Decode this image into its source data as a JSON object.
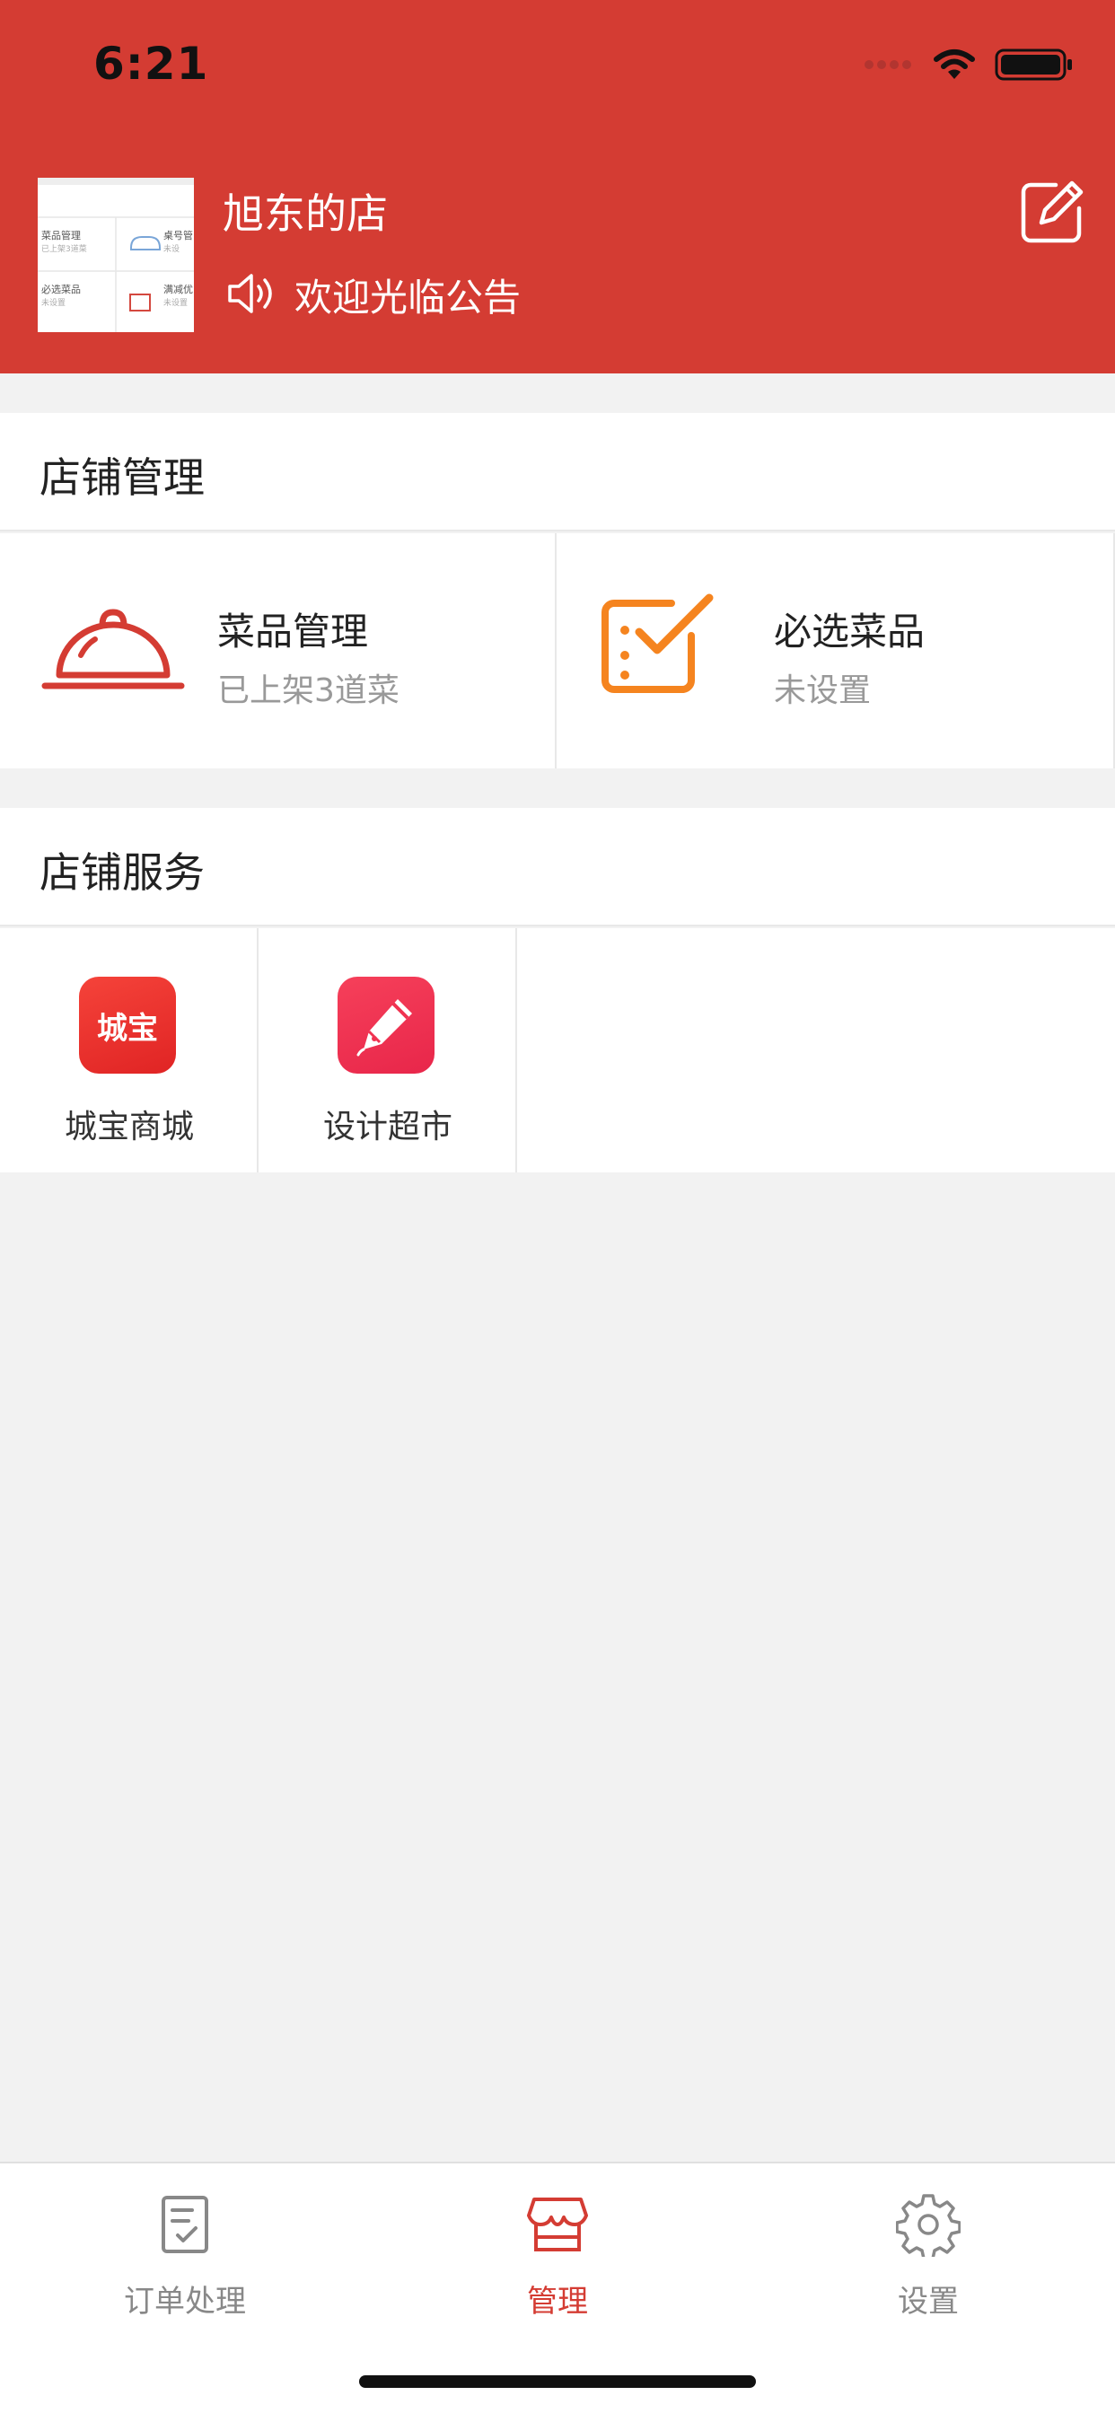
{
  "status_bar": {
    "time": "6:21"
  },
  "shop": {
    "name": "旭东的店",
    "notice": "欢迎光临公告",
    "thumbnail": {
      "top_left": "菜品管理",
      "top_left_sub": "已上架3道菜",
      "top_right": "桌号管",
      "top_right_sub": "未设",
      "bottom_left": "必选菜品",
      "bottom_left_sub": "未设置",
      "bottom_right": "满减优",
      "bottom_right_sub": "未设置"
    }
  },
  "store_management": {
    "title": "店铺管理",
    "items": [
      {
        "title": "菜品管理",
        "subtitle": "已上架3道菜",
        "icon": "cloche-icon"
      },
      {
        "title": "必选菜品",
        "subtitle": "未设置",
        "icon": "checklist-icon"
      }
    ]
  },
  "store_services": {
    "title": "店铺服务",
    "items": [
      {
        "label": "城宝商城",
        "badge": "城宝",
        "icon": "chengbao-app-icon",
        "color": "#ee2d2d"
      },
      {
        "label": "设计超市",
        "icon": "pen-app-icon",
        "color": "#f03250"
      }
    ]
  },
  "tabbar": {
    "items": [
      {
        "label": "订单处理",
        "icon": "order-clipboard-icon",
        "active": false
      },
      {
        "label": "管理",
        "icon": "store-icon",
        "active": true
      },
      {
        "label": "设置",
        "icon": "gear-icon",
        "active": false
      }
    ]
  },
  "colors": {
    "brand_red": "#d43c33",
    "accent_orange": "#f5841f",
    "text_secondary": "#999999",
    "background": "#f2f2f2"
  }
}
